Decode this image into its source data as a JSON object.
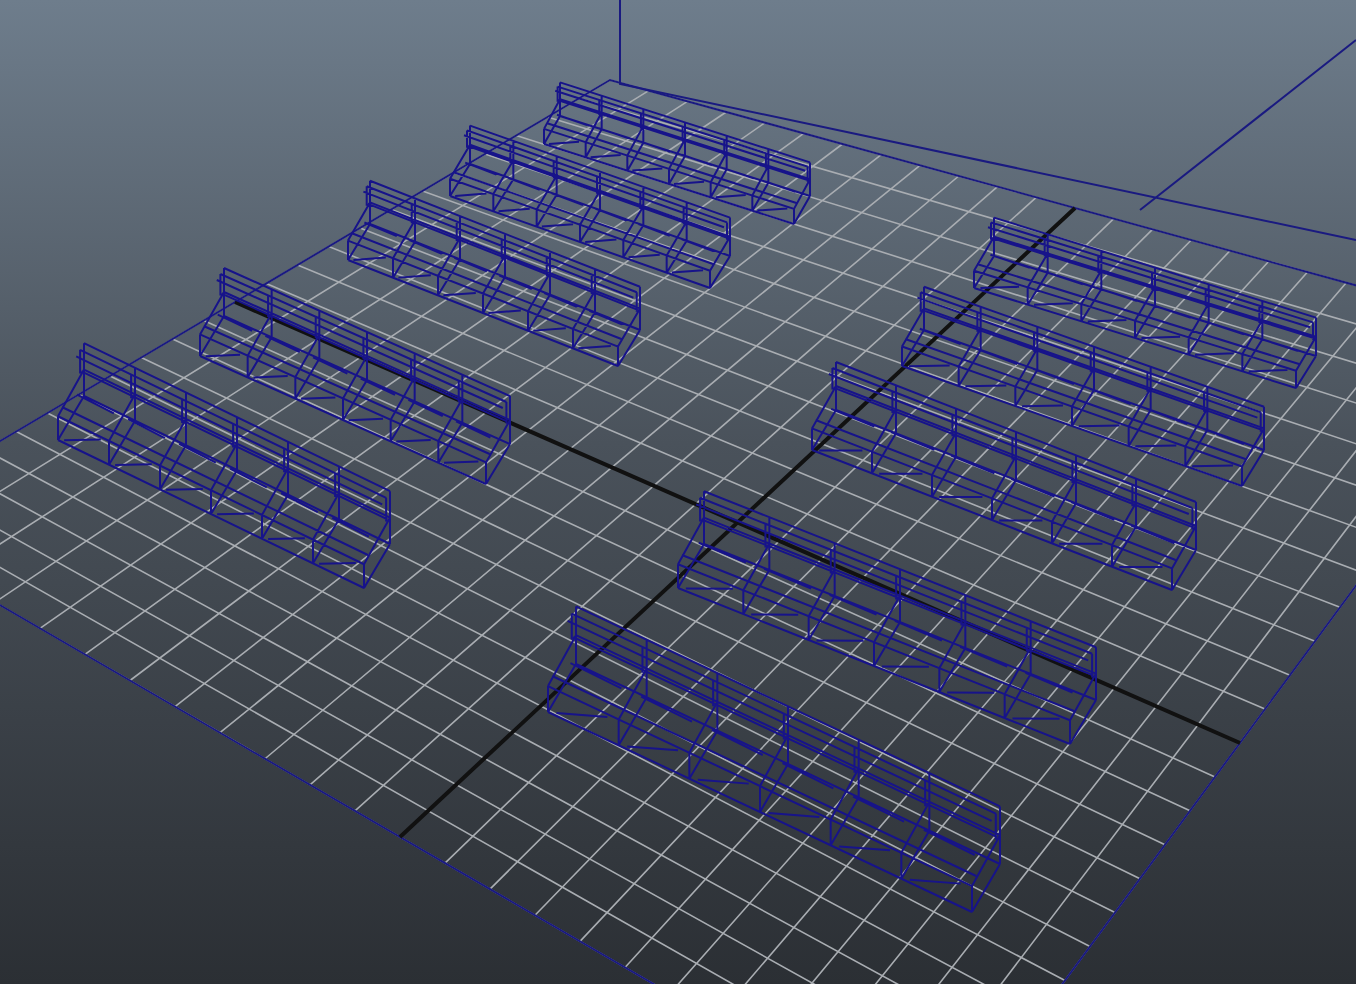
{
  "viewport": {
    "objects": [
      {
        "kind": "grid"
      },
      {
        "kind": "bench"
      },
      {
        "kind": "bench"
      },
      {
        "kind": "bench"
      },
      {
        "kind": "bench"
      },
      {
        "kind": "bench"
      },
      {
        "kind": "bench"
      },
      {
        "kind": "bench"
      },
      {
        "kind": "bench"
      },
      {
        "kind": "bench"
      },
      {
        "kind": "bench"
      }
    ]
  }
}
